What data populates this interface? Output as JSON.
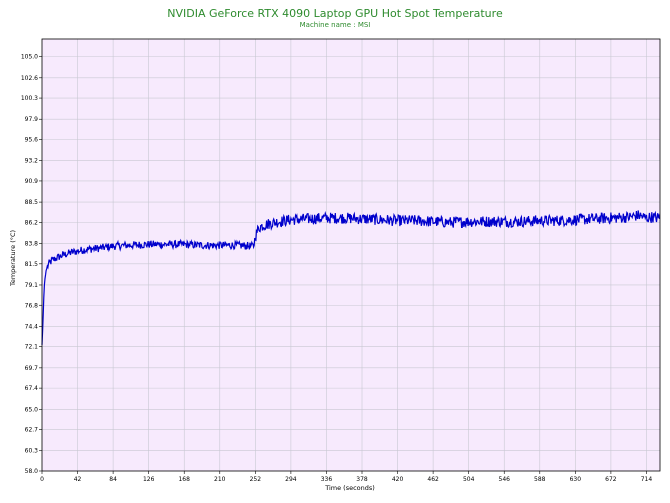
{
  "chart_data": {
    "type": "line",
    "title": "NVIDIA GeForce RTX 4090 Laptop GPU Hot Spot Temperature",
    "subtitle": "Machine name : MSI",
    "xlabel": "Time (seconds)",
    "ylabel": "Temperature (°C)",
    "xlim": [
      0,
      730
    ],
    "ylim": [
      58.0,
      107.0
    ],
    "x_ticks": [
      0,
      42,
      84,
      126,
      168,
      210,
      252,
      294,
      336,
      378,
      420,
      462,
      504,
      546,
      588,
      630,
      672,
      714
    ],
    "y_ticks": [
      58.0,
      60.3,
      62.7,
      65.0,
      67.4,
      69.7,
      72.1,
      74.4,
      76.8,
      79.1,
      81.5,
      83.8,
      86.2,
      88.5,
      90.9,
      93.2,
      95.6,
      97.9,
      100.3,
      102.6,
      105.0
    ],
    "grid": true,
    "series": [
      {
        "color": "#0000cc",
        "x": [
          0,
          1,
          2,
          3,
          5,
          8,
          12,
          18,
          25,
          35,
          50,
          70,
          84,
          100,
          126,
          150,
          168,
          190,
          210,
          230,
          250,
          252,
          256,
          262,
          275,
          294,
          315,
          336,
          357,
          378,
          399,
          420,
          441,
          462,
          483,
          504,
          525,
          546,
          567,
          588,
          609,
          630,
          651,
          672,
          693,
          705,
          714,
          720,
          730
        ],
        "y": [
          72.3,
          74.5,
          77.5,
          79.5,
          80.8,
          81.5,
          81.9,
          82.2,
          82.5,
          82.8,
          83.1,
          83.3,
          83.5,
          83.6,
          83.7,
          83.7,
          83.7,
          83.6,
          83.6,
          83.6,
          83.5,
          84.6,
          85.6,
          85.9,
          86.2,
          86.5,
          86.6,
          86.7,
          86.7,
          86.6,
          86.5,
          86.4,
          86.4,
          86.3,
          86.2,
          86.3,
          86.3,
          86.3,
          86.3,
          86.4,
          86.4,
          86.5,
          86.6,
          86.7,
          86.8,
          87.0,
          86.7,
          86.8,
          86.7
        ],
        "noise": 0.4
      }
    ]
  },
  "colors": {
    "plot_background": "#f7eafd",
    "grid": "#c8c8d2",
    "title": "#2e8b2e",
    "line": "#0000cc"
  }
}
